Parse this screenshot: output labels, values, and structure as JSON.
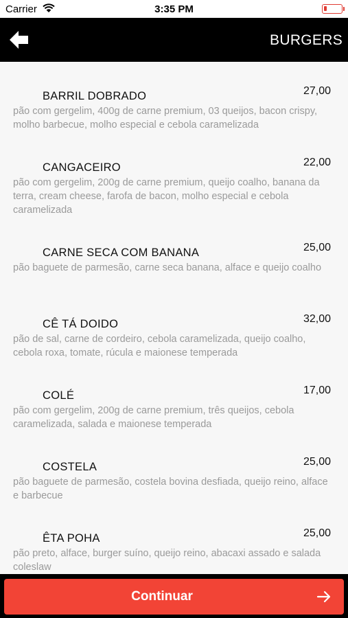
{
  "status_bar": {
    "carrier": "Carrier",
    "time": "3:35 PM"
  },
  "nav": {
    "title": "BURGERS"
  },
  "items": [
    {
      "name": "BARRIL DOBRADO",
      "price": "27,00",
      "description": "pão com gergelim, 400g de carne premium, 03 queijos, bacon crispy, molho barbecue, molho especial e cebola caramelizada"
    },
    {
      "name": "CANGACEIRO",
      "price": "22,00",
      "description": "pão com gergelim, 200g de carne premium, queijo coalho, banana da terra, cream cheese, farofa de bacon, molho especial e cebola caramelizada"
    },
    {
      "name": "CARNE SECA COM BANANA",
      "price": "25,00",
      "description": "pão baguete de parmesão, carne seca banana, alface e queijo coalho"
    },
    {
      "name": "CÊ TÁ DOIDO",
      "price": "32,00",
      "description": "pão de sal, carne de cordeiro, cebola caramelizada, queijo coalho, cebola roxa, tomate, rúcula e maionese temperada"
    },
    {
      "name": "COLÉ",
      "price": "17,00",
      "description": "pão com gergelim, 200g de carne premium, três queijos, cebola caramelizada, salada e maionese temperada"
    },
    {
      "name": "COSTELA",
      "price": "25,00",
      "description": "pão baguete de parmesão, costela bovina desfiada, queijo reino, alface e barbecue"
    },
    {
      "name": "ÊTA POHA",
      "price": "25,00",
      "description": "pão preto, alface, burger suíno, queijo reino, abacaxi assado e salada coleslaw"
    }
  ],
  "footer": {
    "continue_label": "Continuar"
  },
  "colors": {
    "accent": "#f24436",
    "nav_background": "#000000",
    "description_text": "#9a9a9a"
  },
  "icons": {
    "back": "arrow-left-icon",
    "continue": "arrow-right-icon",
    "wifi": "wifi-icon",
    "battery": "battery-icon"
  }
}
